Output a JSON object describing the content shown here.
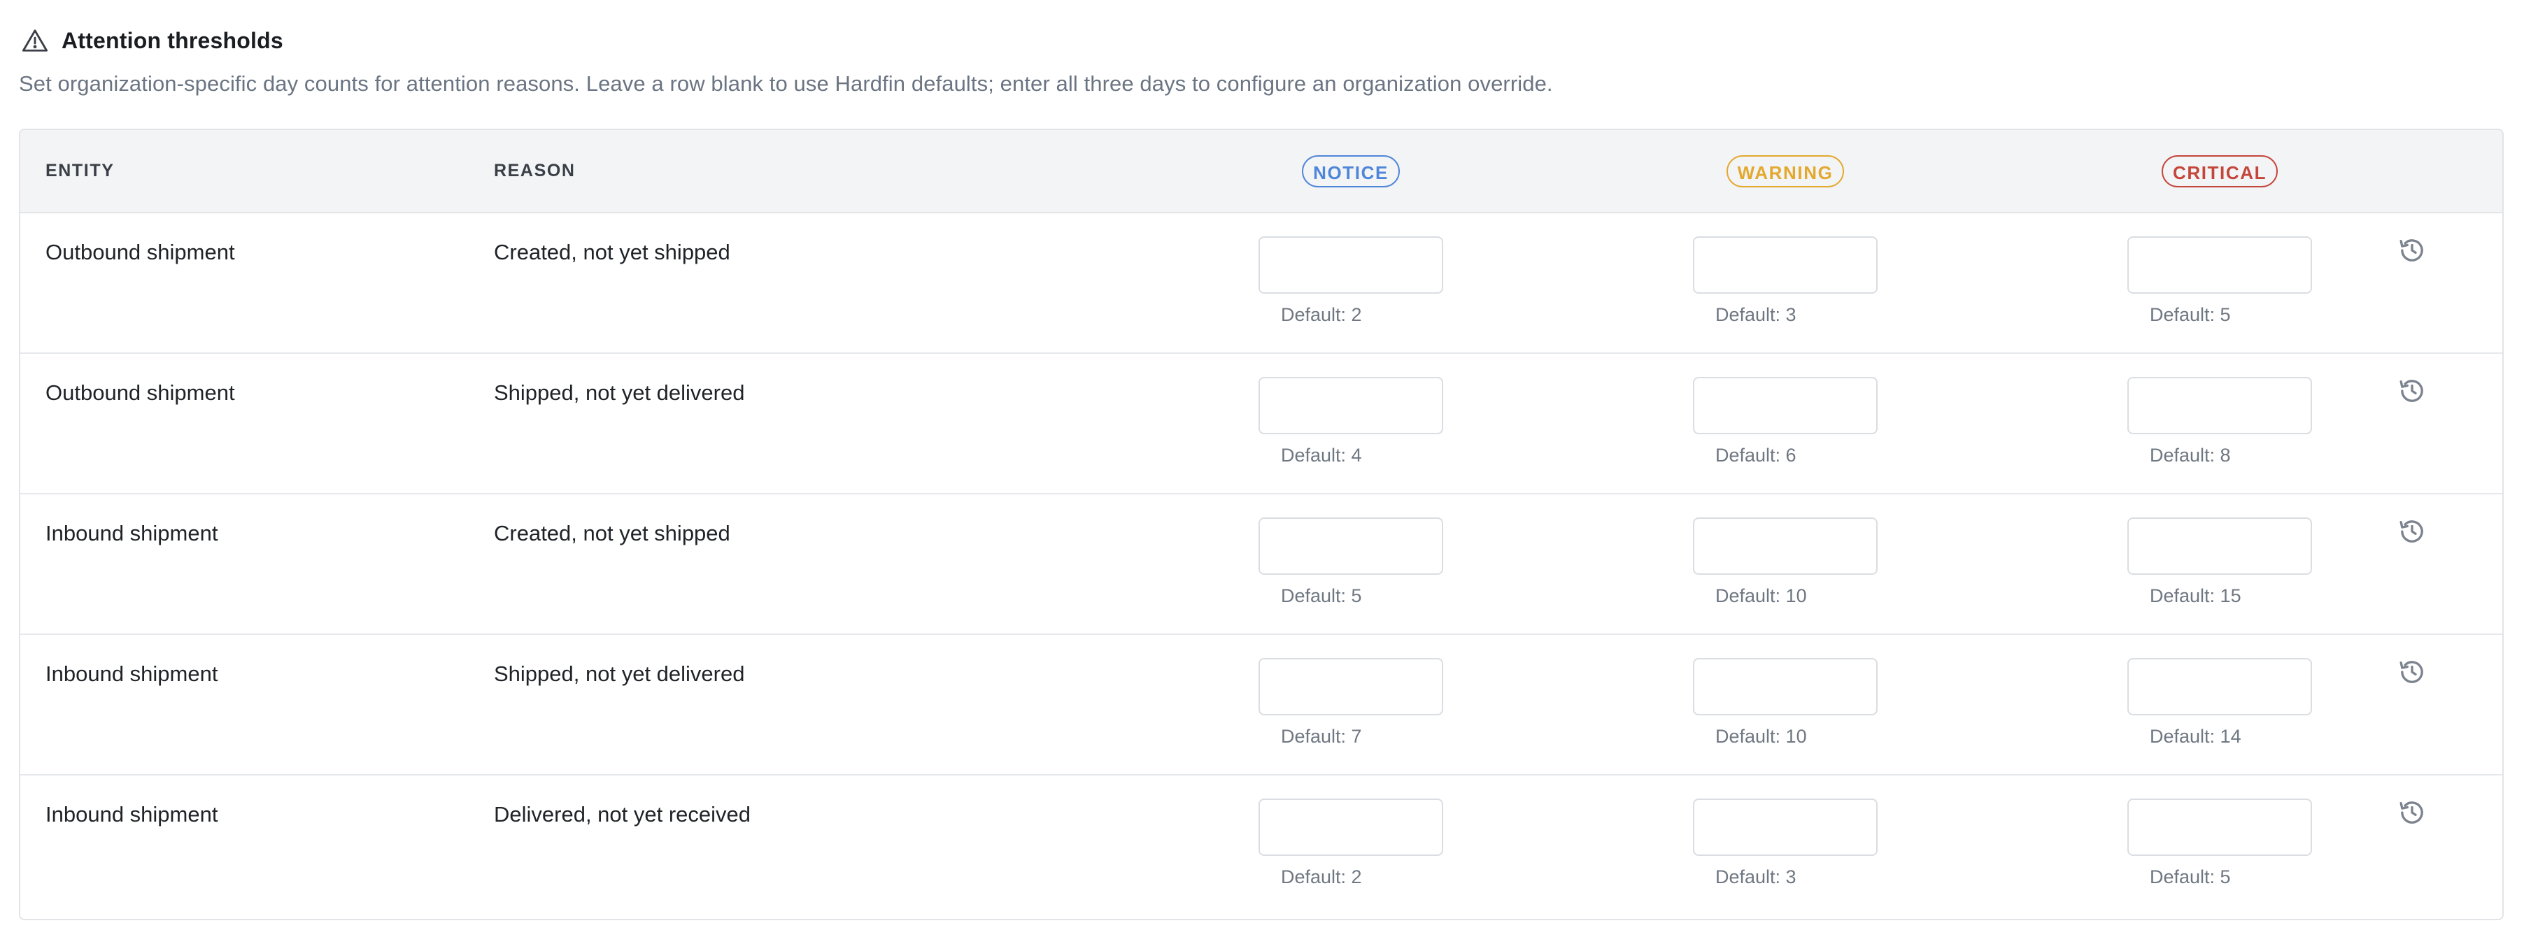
{
  "section": {
    "title": "Attention thresholds",
    "description": "Set organization-specific day counts for attention reasons. Leave a row blank to use Hardfin defaults; enter all three days to configure an organization override.",
    "icon": "warning-triangle-icon"
  },
  "table": {
    "headers": {
      "entity": "ENTITY",
      "reason": "REASON",
      "notice": "NOTICE",
      "warning": "WARNING",
      "critical": "CRITICAL"
    },
    "level_colors": {
      "notice": "#4f86d9",
      "warning": "#e3a92f",
      "critical": "#c4463a"
    },
    "row_action_icon": "history-icon",
    "rows": [
      {
        "entity": "Outbound shipment",
        "reason": "Created, not yet shipped",
        "notice": {
          "value": "",
          "default_label": "Default: 2"
        },
        "warning": {
          "value": "",
          "default_label": "Default: 3"
        },
        "critical": {
          "value": "",
          "default_label": "Default: 5"
        }
      },
      {
        "entity": "Outbound shipment",
        "reason": "Shipped, not yet delivered",
        "notice": {
          "value": "",
          "default_label": "Default: 4"
        },
        "warning": {
          "value": "",
          "default_label": "Default: 6"
        },
        "critical": {
          "value": "",
          "default_label": "Default: 8"
        }
      },
      {
        "entity": "Inbound shipment",
        "reason": "Created, not yet shipped",
        "notice": {
          "value": "",
          "default_label": "Default: 5"
        },
        "warning": {
          "value": "",
          "default_label": "Default: 10"
        },
        "critical": {
          "value": "",
          "default_label": "Default: 15"
        }
      },
      {
        "entity": "Inbound shipment",
        "reason": "Shipped, not yet delivered",
        "notice": {
          "value": "",
          "default_label": "Default: 7"
        },
        "warning": {
          "value": "",
          "default_label": "Default: 10"
        },
        "critical": {
          "value": "",
          "default_label": "Default: 14"
        }
      },
      {
        "entity": "Inbound shipment",
        "reason": "Delivered, not yet received",
        "notice": {
          "value": "",
          "default_label": "Default: 2"
        },
        "warning": {
          "value": "",
          "default_label": "Default: 3"
        },
        "critical": {
          "value": "",
          "default_label": "Default: 5"
        }
      }
    ]
  }
}
